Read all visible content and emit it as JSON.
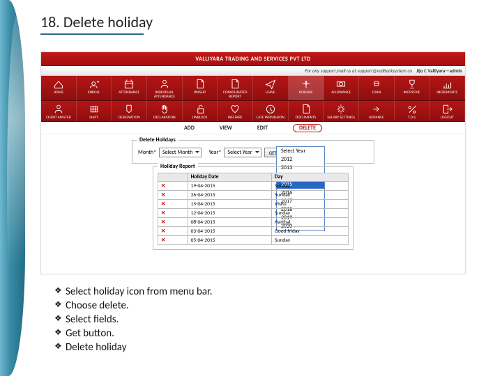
{
  "title": "18. Delete holiday",
  "header": {
    "company": "VALLIYARA TRADING AND SERVICES PVT LTD",
    "support": "For any support,mail us at support@redbacksystem.co",
    "user": "Jijo C Valliyara—admin"
  },
  "nav": {
    "row1": [
      {
        "label": "HOME",
        "icon": "home"
      },
      {
        "label": "ENROLL",
        "icon": "user-plus"
      },
      {
        "label": "ATTENDANCE",
        "icon": "calendar"
      },
      {
        "label": "INDIVIDUAL ATTENDANCE",
        "icon": "person"
      },
      {
        "label": "PAYSLIP",
        "icon": "doc"
      },
      {
        "label": "CONSOLIDATED REPORT",
        "icon": "doc"
      },
      {
        "label": "LEAVE",
        "icon": "plane"
      },
      {
        "label": "HOLIDAY",
        "icon": "palm",
        "active": true
      },
      {
        "label": "ALLOWANCE",
        "icon": "money"
      },
      {
        "label": "LOAN",
        "icon": "coins"
      },
      {
        "label": "INCENTIVE",
        "icon": "trophy"
      },
      {
        "label": "INCREMENTS",
        "icon": "chart"
      }
    ],
    "row2": [
      {
        "label": "CLIENT MASTER",
        "icon": "person"
      },
      {
        "label": "SHIFT",
        "icon": "grid"
      },
      {
        "label": "DESIGNATION",
        "icon": "badge"
      },
      {
        "label": "DECLARATION",
        "icon": "hand"
      },
      {
        "label": "UNBLOCK",
        "icon": "unlock"
      },
      {
        "label": "WELFARE",
        "icon": "heart"
      },
      {
        "label": "LATE PERMISSION",
        "icon": "clock"
      },
      {
        "label": "DOCUMENTS",
        "icon": "doc"
      },
      {
        "label": "SALARY SETTINGS",
        "icon": "gear"
      },
      {
        "label": "ADVANCE",
        "icon": "forward"
      },
      {
        "label": "T.D.S",
        "icon": "percent"
      },
      {
        "label": "LOGOUT",
        "icon": "logout"
      }
    ]
  },
  "actions": {
    "items": [
      "ADD",
      "VIEW",
      "EDIT",
      "DELETE"
    ],
    "active": "DELETE"
  },
  "deleteForm": {
    "legend": "Delete Holidays",
    "monthLabel": "Month",
    "monthValue": "Select Month",
    "yearLabel": "Year",
    "yearValue": "Select Year",
    "getLabel": "GET",
    "yearOptions": [
      "Select Year",
      "2012",
      "2013",
      "2014",
      "2015",
      "2016",
      "2017",
      "2018",
      "2019",
      "2020"
    ],
    "yearHighlighted": "2015"
  },
  "report": {
    "legend": "Holiday Report",
    "headers": [
      "",
      "Holiday Date",
      "Day"
    ],
    "rows": [
      {
        "date": "19-04-2015",
        "day": "Sunday"
      },
      {
        "date": "26-04-2015",
        "day": "Sunday"
      },
      {
        "date": "15-04-2015",
        "day": "Vishu"
      },
      {
        "date": "12-04-2015",
        "day": "Sunday"
      },
      {
        "date": "08-04-2015",
        "day": "Harthal"
      },
      {
        "date": "03-04-2015",
        "day": "Good friday"
      },
      {
        "date": "05-04-2015",
        "day": "Sunday"
      }
    ]
  },
  "steps": [
    "Select holiday icon from menu bar.",
    "Choose delete.",
    "Select fields.",
    "Get button.",
    "Delete holiday"
  ]
}
